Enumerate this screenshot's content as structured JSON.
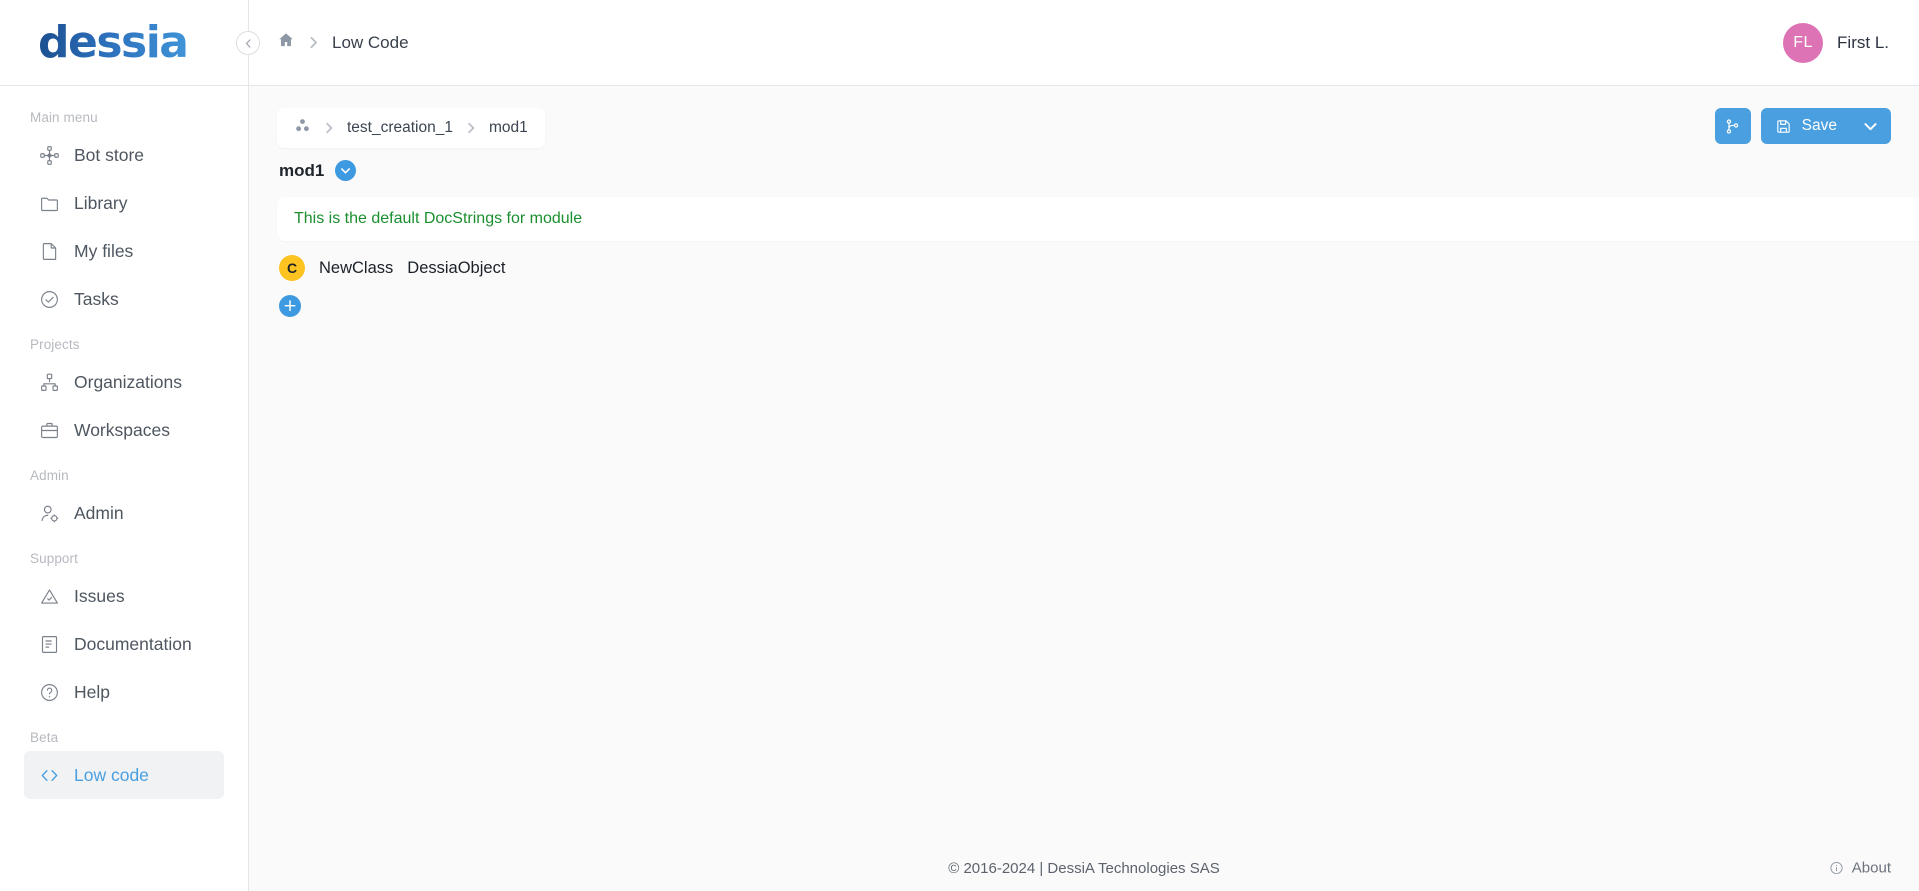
{
  "brand": {
    "logo_text": "dessia",
    "accent": "#4a9fe0"
  },
  "sidebar": {
    "collapse_icon": "chevron-left-icon",
    "sections": [
      {
        "title": "Main menu",
        "items": [
          {
            "label": "Bot store",
            "icon": "bot-network-icon",
            "active": false
          },
          {
            "label": "Library",
            "icon": "folder-icon",
            "active": false
          },
          {
            "label": "My files",
            "icon": "file-icon",
            "active": false
          },
          {
            "label": "Tasks",
            "icon": "check-circle-icon",
            "active": false
          }
        ]
      },
      {
        "title": "Projects",
        "items": [
          {
            "label": "Organizations",
            "icon": "org-chart-icon",
            "active": false
          },
          {
            "label": "Workspaces",
            "icon": "briefcase-icon",
            "active": false
          }
        ]
      },
      {
        "title": "Admin",
        "items": [
          {
            "label": "Admin",
            "icon": "user-gear-icon",
            "active": false
          }
        ]
      },
      {
        "title": "Support",
        "items": [
          {
            "label": "Issues",
            "icon": "warning-triangle-icon",
            "active": false
          },
          {
            "label": "Documentation",
            "icon": "book-icon",
            "active": false
          },
          {
            "label": "Help",
            "icon": "question-circle-icon",
            "active": false
          }
        ]
      },
      {
        "title": "Beta",
        "items": [
          {
            "label": "Low code",
            "icon": "code-brackets-icon",
            "active": true
          }
        ]
      }
    ]
  },
  "topbar": {
    "home_icon": "home-icon",
    "separator_icon": "chevron-right-icon",
    "breadcrumb": "Low Code",
    "user": {
      "initials": "FL",
      "name": "First L.",
      "avatar_color": "#dd73b4"
    }
  },
  "content": {
    "module_breadcrumb": {
      "package_icon": "package-cubes-icon",
      "items": [
        "test_creation_1",
        "mod1"
      ]
    },
    "module_title": "mod1",
    "module_expand_icon": "chevron-down-icon",
    "docstring": "This is the default DocStrings for module",
    "docstring_color": "#1b8f2f",
    "class_entry": {
      "badge": "C",
      "badge_color": "#fcc321",
      "name": "NewClass",
      "base": "DessiaObject"
    },
    "add_button_label": "+",
    "actions": {
      "branch_icon": "git-branch-icon",
      "save_icon": "floppy-disk-icon",
      "save_label": "Save",
      "save_dropdown_icon": "chevron-down-icon"
    }
  },
  "footer": {
    "copyright": "© 2016-2024 | DessiA Technologies SAS",
    "about_label": "About",
    "about_icon": "info-circle-icon"
  }
}
